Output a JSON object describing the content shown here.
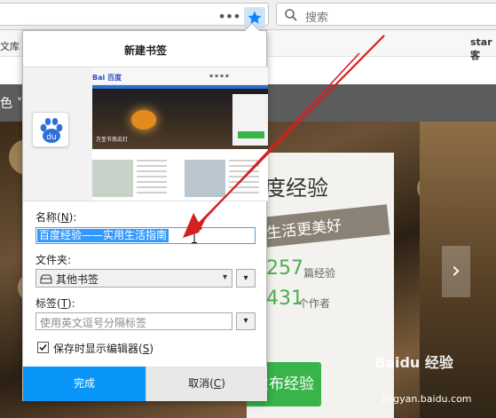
{
  "toolbar": {
    "more_label": "•••",
    "search_placeholder": "搜索",
    "colors": {
      "star_active_bg": "#cfe3f8",
      "star_fill": "#0a84ff"
    }
  },
  "page": {
    "bookmarks_left": "文库",
    "bookmarks_right": "star客",
    "nav_left": "色 ˅",
    "hero_title": "度经验",
    "hero_slogan": "生活更美好",
    "stat1_num": "257",
    "stat1_unit": "篇经验",
    "stat2_num": "431",
    "stat2_unit": "个作者",
    "publish_label": "发布经验",
    "next_arrow": "›",
    "watermark": "Baidu 经验",
    "watermark_sub": "jingyan.baidu.com"
  },
  "popup": {
    "title": "新建书签",
    "preview": {
      "logo": "Bai 百度",
      "links": "▪ ▪ ▪ ▪",
      "hero_text": "万圣节南瓜灯"
    },
    "name": {
      "label": "名称(",
      "key": "N",
      "label_end": "):",
      "value": "百度经验——实用生活指南"
    },
    "folder": {
      "label": "文件夹:",
      "value": "其他书签",
      "dropdown": "▾",
      "expand": "▾"
    },
    "tags": {
      "label": "标签(",
      "key": "T",
      "label_end": "):",
      "placeholder": "使用英文逗号分隔标签",
      "expand": "▾"
    },
    "show_editor": {
      "label": "保存时显示编辑器(",
      "key": "S",
      "label_end": ")",
      "checked": true
    },
    "done_label": "完成",
    "cancel": {
      "label": "取消(",
      "key": "C",
      "label_end": ")"
    },
    "colors": {
      "done_bg": "#0996f8",
      "selection": "#3399ff"
    }
  },
  "annotation": {
    "color": "#d42020"
  }
}
